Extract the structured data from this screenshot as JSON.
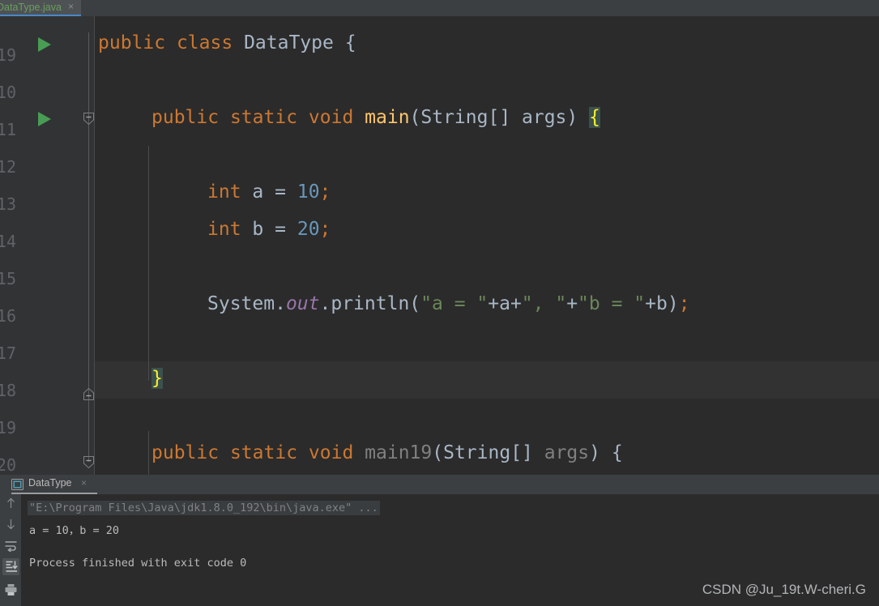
{
  "editor_tab": {
    "filename": "DataType.java",
    "close_icon": "×",
    "accent_color": "#4A88C7",
    "label_color": "#6A9E5F"
  },
  "gutter": {
    "line_numbers": [
      "19",
      "10",
      "11",
      "12",
      "13",
      "14",
      "15",
      "16",
      "17",
      "18",
      "19",
      "20"
    ],
    "run_marker_lines": [
      0,
      2
    ],
    "fold_lines": [
      2,
      9,
      11
    ]
  },
  "code": {
    "language": "java",
    "lines": [
      {
        "number": "19",
        "text": "public class DataType {"
      },
      {
        "number": "10",
        "text": ""
      },
      {
        "number": "11",
        "text": "    public static void main(String[] args) {"
      },
      {
        "number": "12",
        "text": ""
      },
      {
        "number": "13",
        "text": "        int a = 10;"
      },
      {
        "number": "14",
        "text": "        int b = 20;"
      },
      {
        "number": "15",
        "text": ""
      },
      {
        "number": "16",
        "text": "        System.out.println(\"a = \"+a+\", \"+\"b = \"+b);"
      },
      {
        "number": "17",
        "text": ""
      },
      {
        "number": "18",
        "text": "    }"
      },
      {
        "number": "19",
        "text": ""
      },
      {
        "number": "20",
        "text": "    public static void main19(String[] args) {"
      }
    ],
    "tokens": {
      "l9_kw1": "public",
      "l9_kw2": "class",
      "l9_name": "DataType",
      "l9_brace": "{",
      "l11_kw1": "public",
      "l11_kw2": "static",
      "l11_kw3": "void",
      "l11_method": "main",
      "l11_params": "(String[] args)",
      "l11_brace": "{",
      "l13_type": "int",
      "l13_var": "a",
      "l13_eq": "=",
      "l13_val": "10",
      "l13_semi": ";",
      "l14_type": "int",
      "l14_var": "b",
      "l14_eq": "=",
      "l14_val": "20",
      "l14_semi": ";",
      "l16_sys": "System",
      "l16_dot1": ".",
      "l16_out": "out",
      "l16_dot2": ".",
      "l16_println": "println",
      "l16_open": "(",
      "l16_s1": "\"a = \"",
      "l16_p1": "+a+",
      "l16_s2": "\", \"",
      "l16_p2": "+",
      "l16_s3": "\"b = \"",
      "l16_p3": "+b",
      "l16_close": ")",
      "l16_semi": ";",
      "l18_brace": "}",
      "l20_kw1": "public",
      "l20_kw2": "static",
      "l20_kw3": "void",
      "l20_method": "main19",
      "l20_params_a": "(",
      "l20_params_b": "String[]",
      "l20_params_c": " args",
      "l20_params_d": ")",
      "l20_brace": "{"
    },
    "colors": {
      "keyword": "#CC7832",
      "identifier": "#A9B7C6",
      "method": "#FFC66D",
      "number": "#6897BB",
      "string": "#6A8759",
      "field": "#9876AA",
      "dimmed": "#808080",
      "brace_match_fg": "#FFEF28",
      "brace_match_bg": "#3B514D",
      "background": "#2B2B2B",
      "gutter_background": "#313335",
      "caret_line": "#323232"
    }
  },
  "run_panel": {
    "tab_label": "DataType",
    "tab_icon": "console-window-icon",
    "close_icon": "×",
    "toolbar": [
      {
        "name": "up-arrow-icon",
        "glyph": "↑",
        "selected": false
      },
      {
        "name": "down-arrow-icon",
        "glyph": "↓",
        "selected": false
      },
      {
        "name": "soft-wrap-icon",
        "glyph": "⤶",
        "selected": false
      },
      {
        "name": "scroll-to-end-icon",
        "glyph": "⤓",
        "selected": true
      },
      {
        "name": "print-icon",
        "glyph": "🖶",
        "selected": false
      }
    ],
    "output": [
      {
        "text": "\"E:\\Program Files\\Java\\jdk1.8.0_192\\bin\\java.exe\" ...",
        "kind": "command"
      },
      {
        "text": "a = 10，b = 20",
        "kind": "stdout"
      },
      {
        "text": "",
        "kind": "stdout"
      },
      {
        "text": "Process finished with exit code 0",
        "kind": "stdout"
      }
    ]
  },
  "watermark": {
    "text": "CSDN @Ju_19t.W-cheri.G"
  }
}
